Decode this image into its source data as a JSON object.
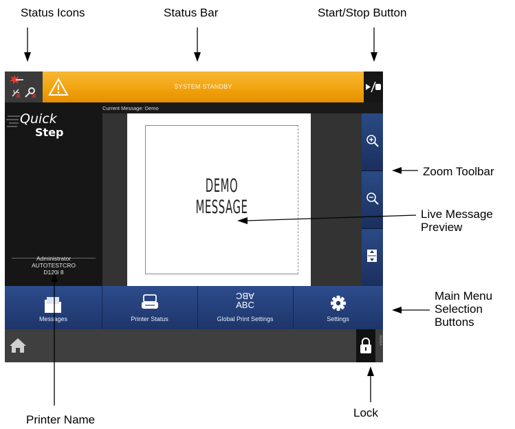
{
  "callouts": {
    "status_icons": "Status Icons",
    "status_bar": "Status Bar",
    "start_stop": "Start/Stop Button",
    "zoom_toolbar": "Zoom Toolbar",
    "live_preview_1": "Live Message",
    "live_preview_2": "Preview",
    "main_menu_1": "Main Menu",
    "main_menu_2": "Selection",
    "main_menu_3": "Buttons",
    "printer_name": "Printer Name",
    "lock": "Lock"
  },
  "screen": {
    "status_icons": [
      "laser-warning-icon",
      "usb-error-icon",
      "key-icon"
    ],
    "status_bar": {
      "warning_icon": "warning-triangle-icon",
      "text": "SYSTEM STANDBY",
      "color": "#f3a40e"
    },
    "start_stop": {
      "icon": "play-stop-icon",
      "label": "▸/■"
    },
    "logo": {
      "line1": "Quick",
      "line2": "Step"
    },
    "current_message": "Current Message: Demo",
    "preview_text": "DEMO MESSAGE",
    "zoom": [
      "zoom-in-icon",
      "zoom-out-icon",
      "fit-page-icon"
    ],
    "printer_info": {
      "user": "Administrator",
      "name": "AUTOTESTCRO",
      "model": "D120i 8"
    },
    "menu": [
      {
        "label": "Messages",
        "icon": "folder-icon"
      },
      {
        "label": "Printer Status",
        "icon": "printer-icon"
      },
      {
        "label": "Global Print Settings",
        "icon_text_top": "ABC",
        "icon_text_bottom": "ABC",
        "icon": "abc-rotate-icon"
      },
      {
        "label": "Settings",
        "icon": "gear-icon"
      }
    ],
    "home_icon": "home-icon",
    "lock_icon": "lock-icon",
    "version": "0008A",
    "accent": "#2b4a86"
  }
}
